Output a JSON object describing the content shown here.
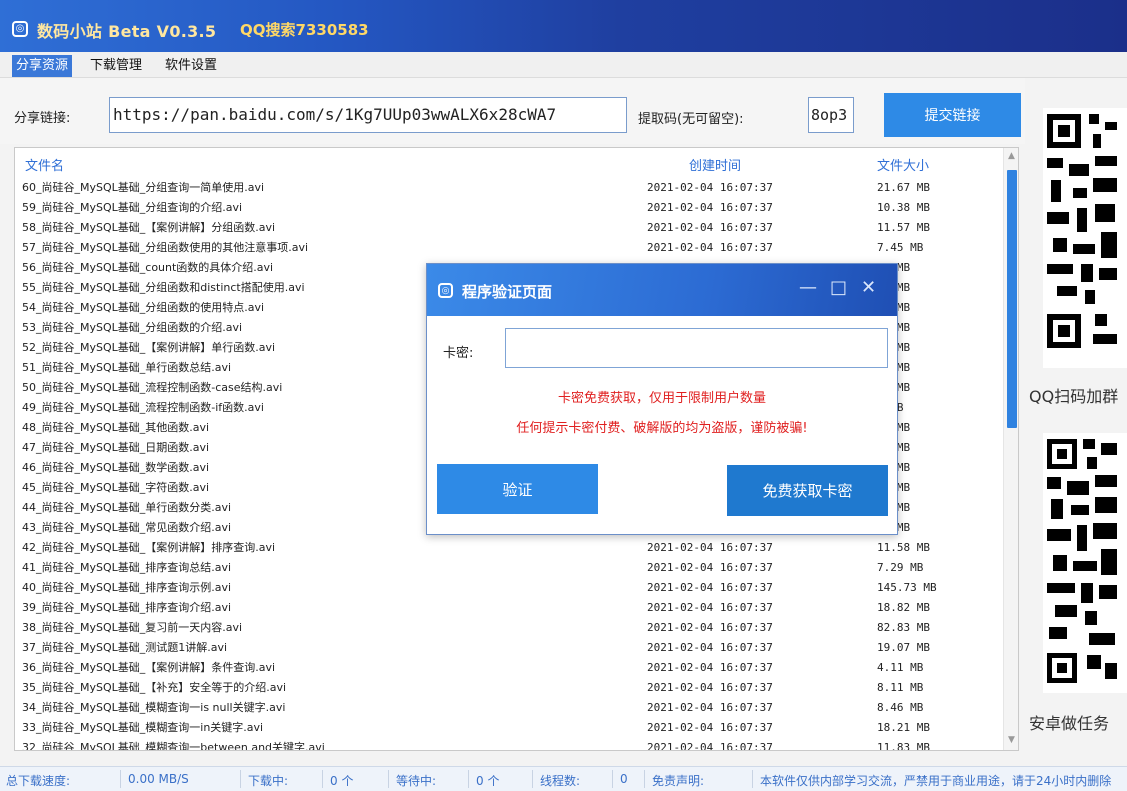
{
  "window": {
    "title": "数码小站 Beta V0.3.5",
    "subtitle": "QQ搜索7330583"
  },
  "menu": {
    "tabs": [
      "分享资源",
      "下载管理",
      "软件设置"
    ]
  },
  "share": {
    "link_label": "分享链接:",
    "link_value": "https://pan.baidu.com/s/1Kg7UUp03wwALX6x28cWA7",
    "code_label": "提取码(无可留空):",
    "code_value": "8op3",
    "submit_label": "提交链接"
  },
  "table": {
    "headers": {
      "name": "文件名",
      "time": "创建时间",
      "size": "文件大小"
    },
    "rows": [
      {
        "name": "60_尚硅谷_MySQL基础_分组查询一简单使用.avi",
        "time": "2021-02-04 16:07:37",
        "size": "21.67 MB"
      },
      {
        "name": "59_尚硅谷_MySQL基础_分组查询的介绍.avi",
        "time": "2021-02-04 16:07:37",
        "size": "10.38 MB"
      },
      {
        "name": "58_尚硅谷_MySQL基础_【案例讲解】分组函数.avi",
        "time": "2021-02-04 16:07:37",
        "size": "11.57 MB"
      },
      {
        "name": "57_尚硅谷_MySQL基础_分组函数使用的其他注意事项.avi",
        "time": "2021-02-04 16:07:37",
        "size": "7.45 MB"
      },
      {
        "name": "56_尚硅谷_MySQL基础_count函数的具体介绍.avi",
        "time": "",
        "size": "21 MB"
      },
      {
        "name": "55_尚硅谷_MySQL基础_分组函数和distinct搭配使用.avi",
        "time": "",
        "size": "23 MB"
      },
      {
        "name": "54_尚硅谷_MySQL基础_分组函数的使用特点.avi",
        "time": "",
        "size": "72 MB"
      },
      {
        "name": "53_尚硅谷_MySQL基础_分组函数的介绍.avi",
        "time": "",
        "size": "55 MB"
      },
      {
        "name": "52_尚硅谷_MySQL基础_【案例讲解】单行函数.avi",
        "time": "",
        "size": "39 MB"
      },
      {
        "name": "51_尚硅谷_MySQL基础_单行函数总结.avi",
        "time": "",
        "size": "72 MB"
      },
      {
        "name": "50_尚硅谷_MySQL基础_流程控制函数-case结构.avi",
        "time": "",
        "size": "13 MB"
      },
      {
        "name": "49_尚硅谷_MySQL基础_流程控制函数-if函数.avi",
        "time": "",
        "size": "8 MB"
      },
      {
        "name": "48_尚硅谷_MySQL基础_其他函数.avi",
        "time": "",
        "size": "06 MB"
      },
      {
        "name": "47_尚硅谷_MySQL基础_日期函数.avi",
        "time": "",
        "size": "05 MB"
      },
      {
        "name": "46_尚硅谷_MySQL基础_数学函数.avi",
        "time": "",
        "size": "26 MB"
      },
      {
        "name": "45_尚硅谷_MySQL基础_字符函数.avi",
        "time": "",
        "size": "24 MB"
      },
      {
        "name": "44_尚硅谷_MySQL基础_单行函数分类.avi",
        "time": "",
        "size": "05 MB"
      },
      {
        "name": "43_尚硅谷_MySQL基础_常见函数介绍.avi",
        "time": "",
        "size": "16 MB"
      },
      {
        "name": "42_尚硅谷_MySQL基础_【案例讲解】排序查询.avi",
        "time": "2021-02-04 16:07:37",
        "size": "11.58 MB"
      },
      {
        "name": "41_尚硅谷_MySQL基础_排序查询总结.avi",
        "time": "2021-02-04 16:07:37",
        "size": "7.29 MB"
      },
      {
        "name": "40_尚硅谷_MySQL基础_排序查询示例.avi",
        "time": "2021-02-04 16:07:37",
        "size": "145.73 MB"
      },
      {
        "name": "39_尚硅谷_MySQL基础_排序查询介绍.avi",
        "time": "2021-02-04 16:07:37",
        "size": "18.82 MB"
      },
      {
        "name": "38_尚硅谷_MySQL基础_复习前一天内容.avi",
        "time": "2021-02-04 16:07:37",
        "size": "82.83 MB"
      },
      {
        "name": "37_尚硅谷_MySQL基础_测试题1讲解.avi",
        "time": "2021-02-04 16:07:37",
        "size": "19.07 MB"
      },
      {
        "name": "36_尚硅谷_MySQL基础_【案例讲解】条件查询.avi",
        "time": "2021-02-04 16:07:37",
        "size": "4.11 MB"
      },
      {
        "name": "35_尚硅谷_MySQL基础_【补充】安全等于的介绍.avi",
        "time": "2021-02-04 16:07:37",
        "size": "8.11 MB"
      },
      {
        "name": "34_尚硅谷_MySQL基础_模糊查询一is null关键字.avi",
        "time": "2021-02-04 16:07:37",
        "size": "8.46 MB"
      },
      {
        "name": "33_尚硅谷_MySQL基础_模糊查询一in关键字.avi",
        "time": "2021-02-04 16:07:37",
        "size": "18.21 MB"
      },
      {
        "name": "32_尚硅谷_MySQL基础_模糊查询一between and关键字.avi",
        "time": "2021-02-04 16:07:37",
        "size": "11.83 MB"
      }
    ]
  },
  "side": {
    "qr_caption_1": "QQ扫码加群",
    "qr_caption_2": "安卓做任务"
  },
  "status": {
    "speed_label": "总下载速度:",
    "speed_value": "0.00 MB/S",
    "downloading_label": "下载中:",
    "downloading_value": "0 个",
    "waiting_label": "等待中:",
    "waiting_value": "0 个",
    "threads_label": "线程数:",
    "threads_value": "0",
    "disclaimer_label": "免责声明:",
    "disclaimer_text": "本软件仅供内部学习交流，严禁用于商业用途，请于24小时内删除"
  },
  "dialog": {
    "title": "程序验证页面",
    "key_label": "卡密:",
    "key_value": "",
    "notice_1": "卡密免费获取，仅用于限制用户数量",
    "notice_2": "任何提示卡密付费、破解版的均为盗版，谨防被骗!",
    "verify_label": "验证",
    "get_key_label": "免费获取卡密",
    "controls": [
      "—",
      "□",
      "✕"
    ]
  },
  "colors": {
    "accent": "#2e8ae6",
    "warning": "#e02020",
    "header_text": "#2f6fd6"
  },
  "icons": [
    "app-logo-icon",
    "minimize-icon",
    "maximize-icon",
    "close-icon",
    "scroll-up-icon",
    "scroll-down-icon",
    "qr-code-icon"
  ]
}
